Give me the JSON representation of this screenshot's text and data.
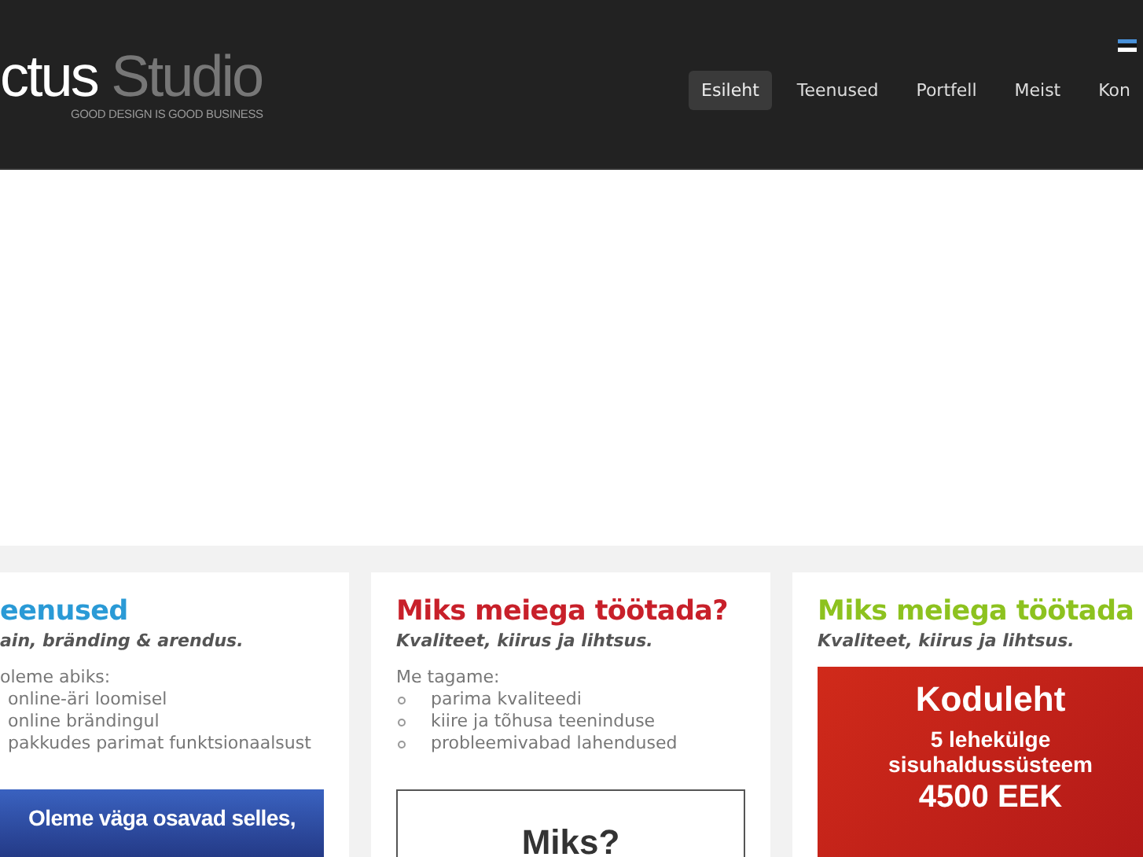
{
  "header": {
    "logo_main": "ctus",
    "logo_accent": "Studio",
    "tagline": "GOOD DESIGN IS GOOD BUSINESS",
    "nav": [
      {
        "label": "Esileht",
        "selected": true
      },
      {
        "label": "Teenused",
        "selected": false
      },
      {
        "label": "Portfell",
        "selected": false
      },
      {
        "label": "Meist",
        "selected": false
      },
      {
        "label": "Kon",
        "selected": false
      }
    ]
  },
  "cards": [
    {
      "kind": "list",
      "color": "#2a9ad6",
      "title": "eenused",
      "subtitle": "ain, bränding & arendus.",
      "intro": "oleme abiks:",
      "bullets_shown": false,
      "items": [
        "online-äri loomisel",
        "online brändingul",
        "pakkudes parimat funktsionaalsust"
      ],
      "banner": {
        "kind": "blue",
        "lines": [
          "Oleme väga osavad selles,"
        ]
      }
    },
    {
      "kind": "list",
      "color": "#c8202a",
      "title": "Miks meiega töötada?",
      "subtitle": "Kvaliteet, kiirus ja lihtsus.",
      "intro": "Me tagame:",
      "bullets_shown": true,
      "items": [
        "parima kvaliteedi",
        "kiire ja tõhusa teeninduse",
        "probleemivabad lahendused"
      ],
      "banner": {
        "kind": "outline",
        "lines": [
          "Miks?"
        ]
      }
    },
    {
      "kind": "banner",
      "color": "#8dc21f",
      "title": "Miks meiega töötada",
      "subtitle": "Kvaliteet, kiirus ja lihtsus.",
      "banner": {
        "kind": "red",
        "lines": [
          "Koduleht",
          "5 lehekülge",
          "sisuhaldussüsteem",
          "4500 EEK"
        ]
      }
    }
  ]
}
